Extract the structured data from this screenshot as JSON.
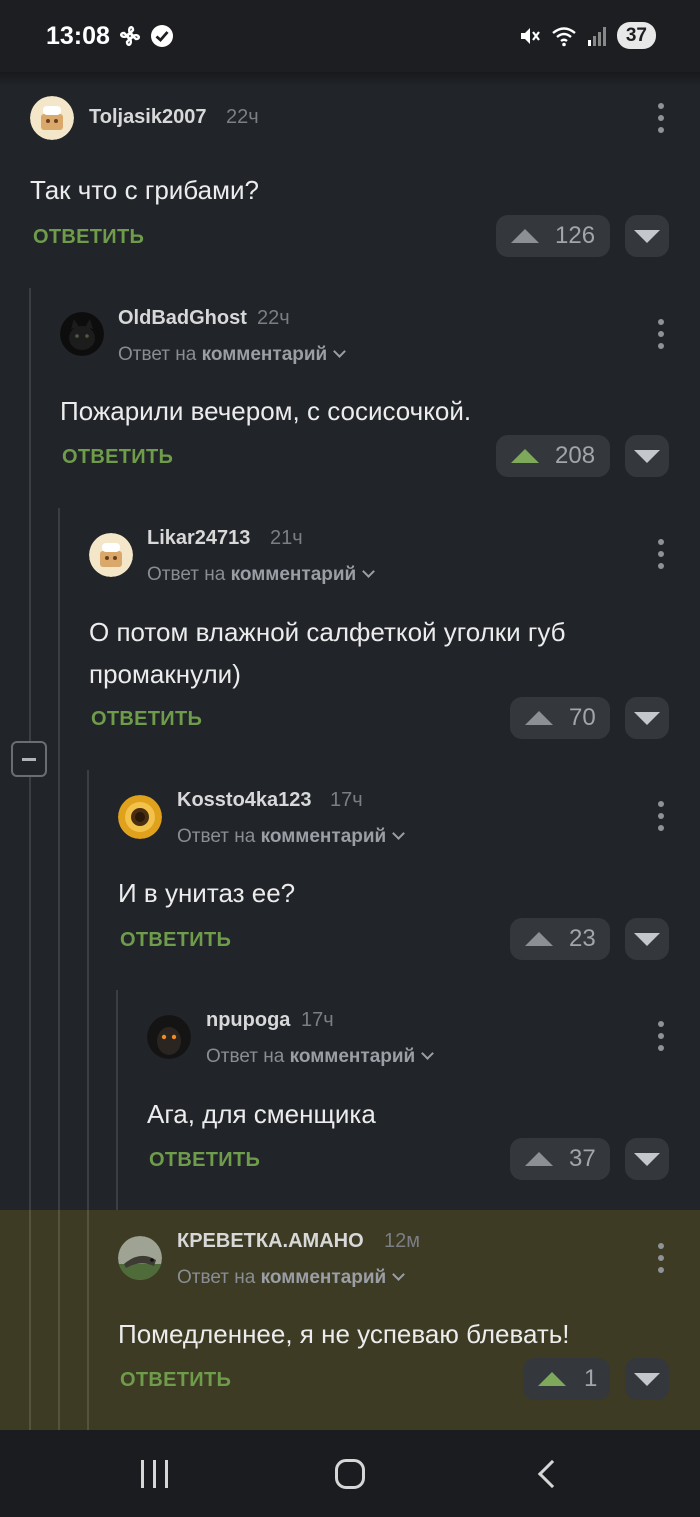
{
  "status_bar": {
    "time": "13:08",
    "battery": "37"
  },
  "labels": {
    "reply": "ОТВЕТИТЬ",
    "reply_to_prefix": "Ответ на",
    "reply_to_target": "комментарий"
  },
  "comments": [
    {
      "author": "Toljasik2007",
      "time": "22ч",
      "text": "Так что с грибами?",
      "votes": "126",
      "upvoted": false
    },
    {
      "author": "OldBadGhost",
      "time": "22ч",
      "text": "Пожарили вечером, с сосисочкой.",
      "votes": "208",
      "upvoted": true
    },
    {
      "author": "Likar24713",
      "time": "21ч",
      "text": "О потом влажной салфеткой уголки губ промакнули)",
      "votes": "70",
      "upvoted": false
    },
    {
      "author": "Kossto4ka123",
      "time": "17ч",
      "text": "И в унитаз ее?",
      "votes": "23",
      "upvoted": false
    },
    {
      "author": "npupoga",
      "time": "17ч",
      "text": "Ага, для сменщика",
      "votes": "37",
      "upvoted": false
    },
    {
      "author": "КРЕВЕТКА.АМАНО",
      "time": "12м",
      "text": "Помедленнее, я не успеваю блевать!",
      "votes": "1",
      "upvoted": true
    }
  ],
  "colors": {
    "background": "#212429",
    "reply_green": "#6f9c4b",
    "highlight": "#3d3b24"
  }
}
